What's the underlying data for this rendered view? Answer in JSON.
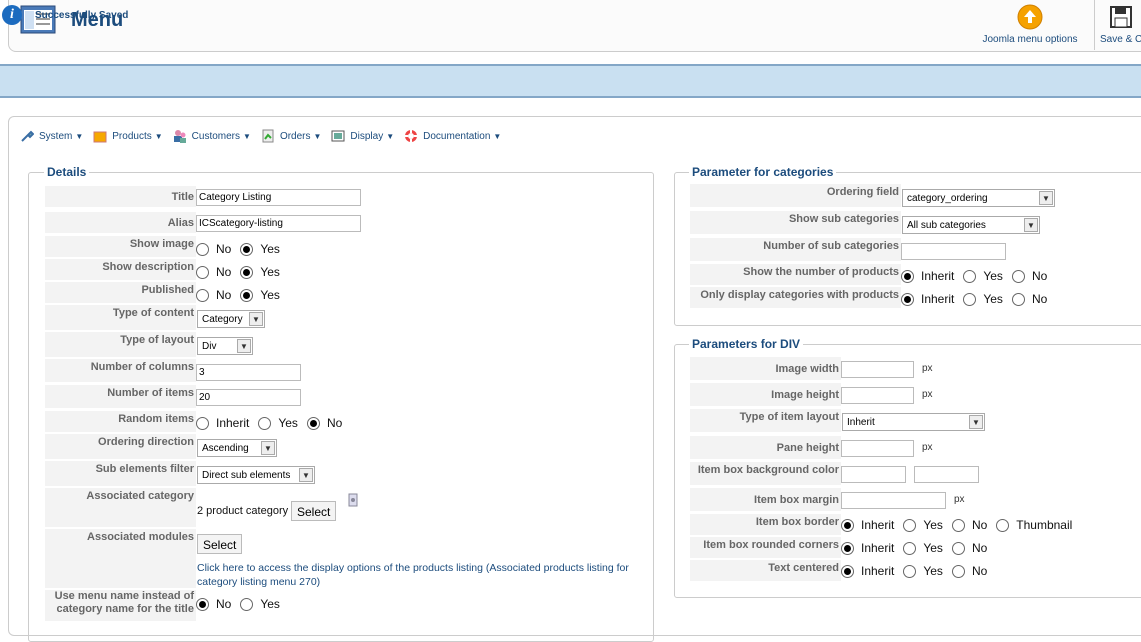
{
  "header": {
    "title": "Menu",
    "toolbar": {
      "joomla_label": "Joomla menu options",
      "save_label": "Save & C"
    }
  },
  "message": {
    "text": "Successfully Saved"
  },
  "topmenu": [
    {
      "label": "System"
    },
    {
      "label": "Products"
    },
    {
      "label": "Customers"
    },
    {
      "label": "Orders"
    },
    {
      "label": "Display"
    },
    {
      "label": "Documentation"
    }
  ],
  "details": {
    "legend": "Details",
    "title_label": "Title",
    "title_value": "Category Listing",
    "alias_label": "Alias",
    "alias_value": "ICScategory-listing",
    "show_image_label": "Show image",
    "show_description_label": "Show description",
    "published_label": "Published",
    "no": "No",
    "yes": "Yes",
    "inherit": "Inherit",
    "type_content_label": "Type of content",
    "type_content_value": "Category",
    "type_layout_label": "Type of layout",
    "type_layout_value": "Div",
    "num_columns_label": "Number of columns",
    "num_columns_value": "3",
    "num_items_label": "Number of items",
    "num_items_value": "20",
    "random_items_label": "Random items",
    "ordering_dir_label": "Ordering direction",
    "ordering_dir_value": "Ascending",
    "sub_filter_label": "Sub elements filter",
    "sub_filter_value": "Direct sub elements",
    "assoc_category_label": "Associated category",
    "assoc_category_value": "2 product category",
    "select_label": "Select",
    "assoc_modules_label": "Associated modules",
    "link_text": "Click here to access the display options of the products listing (Associated products listing for category listing menu 270)",
    "use_menu_name_label": "Use menu name instead of category name for the title"
  },
  "categories": {
    "legend": "Parameter for categories",
    "ordering_field_label": "Ordering field",
    "ordering_field_value": "category_ordering",
    "show_sub_label": "Show sub categories",
    "show_sub_value": "All sub categories",
    "num_sub_label": "Number of sub categories",
    "num_sub_value": "",
    "show_number_label": "Show the number of products",
    "only_display_label": "Only display categories with products"
  },
  "div": {
    "legend": "Parameters for DIV",
    "image_width_label": "Image width",
    "image_height_label": "Image height",
    "type_item_layout_label": "Type of item layout",
    "type_item_layout_value": "Inherit",
    "pane_height_label": "Pane height",
    "item_bg_label": "Item box background color",
    "item_margin_label": "Item box margin",
    "item_border_label": "Item box border",
    "item_rounded_label": "Item box rounded corners",
    "text_centered_label": "Text centered",
    "thumbnail": "Thumbnail",
    "px": "px"
  }
}
